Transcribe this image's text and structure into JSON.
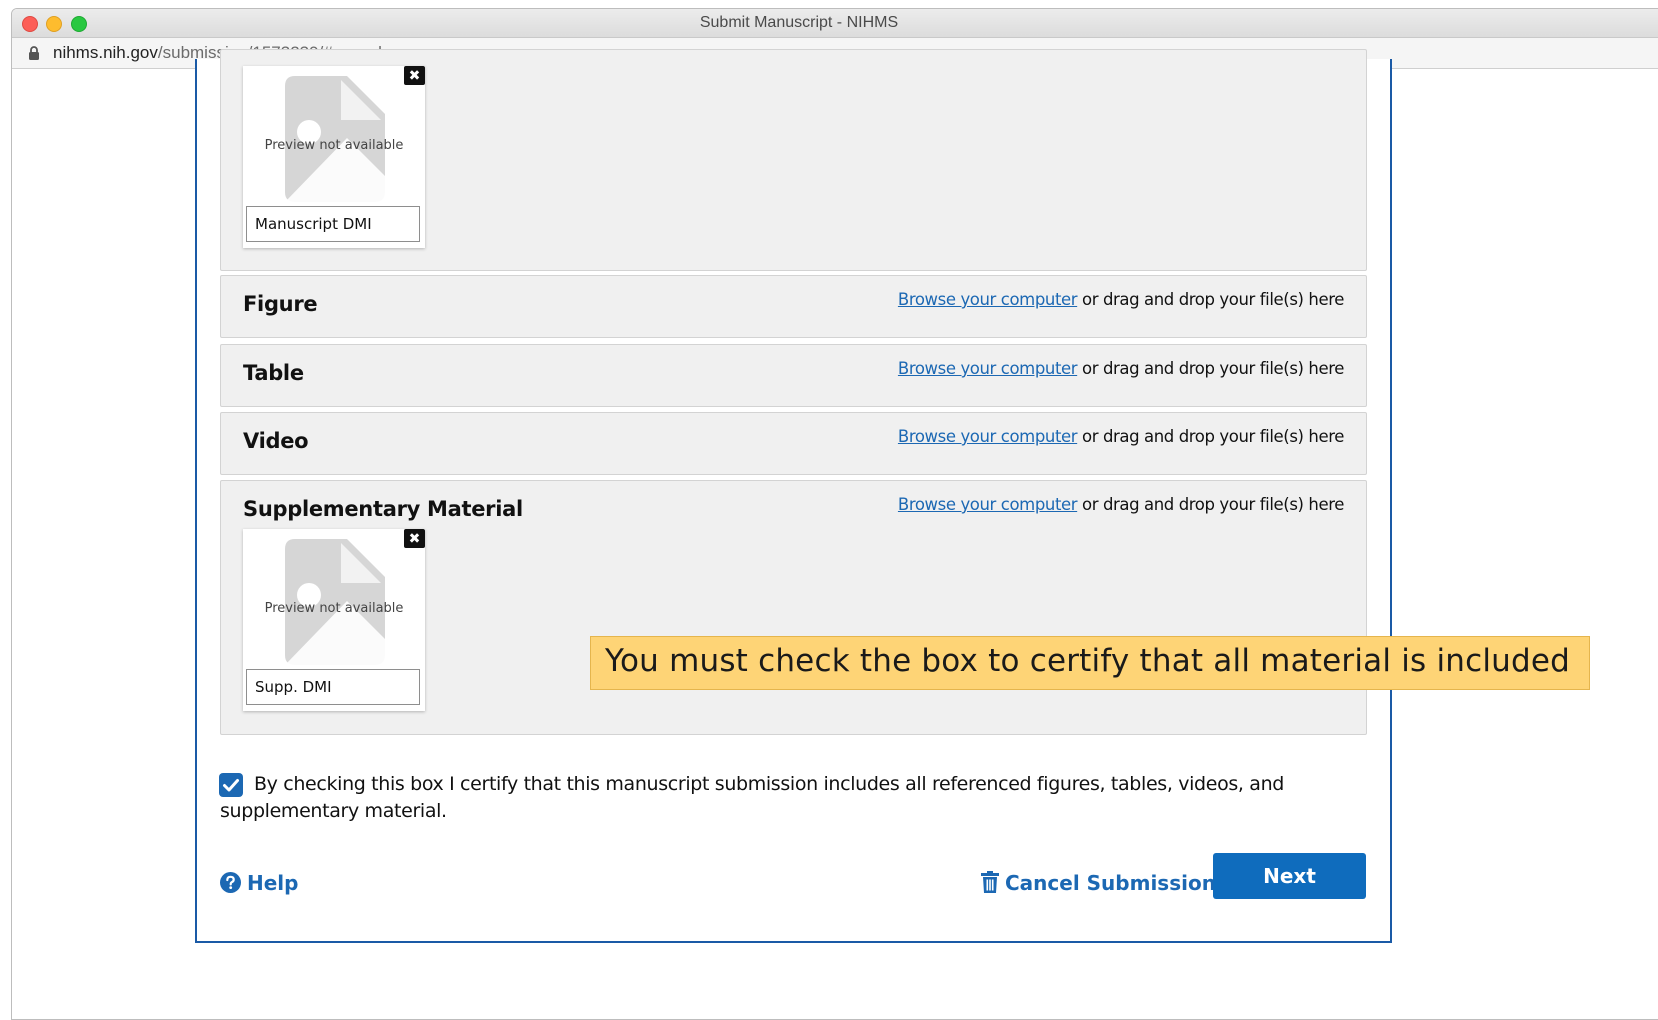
{
  "window": {
    "title": "Submit Manuscript - NIHMS",
    "url_domain": "nihms.nih.gov",
    "url_path": "/submission/1573239/#cancel"
  },
  "manuscript_panel": {
    "file": {
      "preview_text": "Preview not available",
      "name": "Manuscript DMI",
      "remove_icon": "close-icon"
    }
  },
  "file_sections": [
    {
      "title": "Figure",
      "browse_link": "Browse your computer",
      "browse_suffix": " or drag and drop your file(s) here"
    },
    {
      "title": "Table",
      "browse_link": "Browse your computer",
      "browse_suffix": " or drag and drop your file(s) here"
    },
    {
      "title": "Video",
      "browse_link": "Browse your computer",
      "browse_suffix": " or drag and drop your file(s) here"
    },
    {
      "title": "Supplementary Material",
      "browse_link": "Browse your computer",
      "browse_suffix": " or drag and drop your file(s) here",
      "file": {
        "preview_text": "Preview not available",
        "name": "Supp. DMI"
      }
    }
  ],
  "tooltip": {
    "text": "You must check the box to certify that all material is included"
  },
  "certify": {
    "checked": true,
    "text": "By checking this box I certify that this manuscript submission includes all referenced figures, tables, videos, and supplementary material."
  },
  "footer": {
    "help_label": "Help",
    "cancel_label": "Cancel Submission",
    "next_label": "Next"
  },
  "colors": {
    "link": "#1c68b3",
    "primary_button": "#0f6cbd",
    "tooltip_bg": "#fed476",
    "modal_border": "#1a5aa6"
  }
}
